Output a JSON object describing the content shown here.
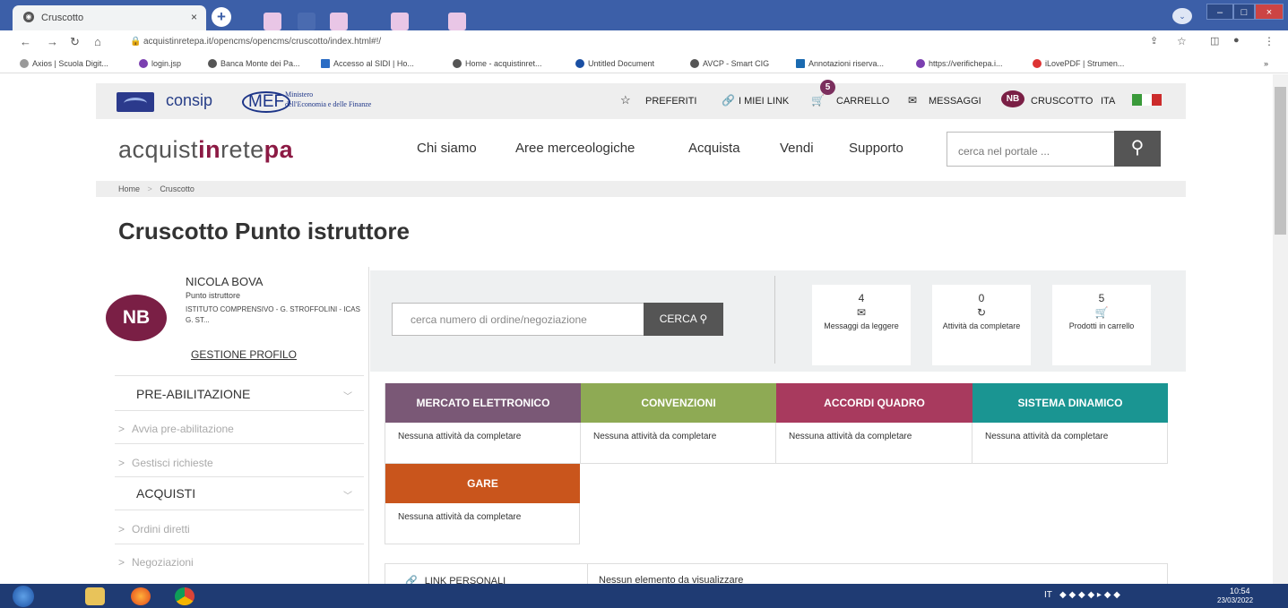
{
  "browser": {
    "tab_title": "Cruscotto",
    "tab_close": "×",
    "new_tab": "+",
    "url": "acquistinretepa.it/opencms/opencms/cruscotto/index.html#!/",
    "bookmarks": [
      "Axios | Scuola Digit...",
      "login.jsp",
      "Banca Monte dei Pa...",
      "Accesso al SIDI | Ho...",
      "Home - acquistinret...",
      "Untitled Document",
      "AVCP - Smart CIG",
      "Annotazioni riserva...",
      "https://verifichepa.i...",
      "iLovePDF | Strumen..."
    ]
  },
  "header": {
    "consip": "consip",
    "mef": "MEF",
    "mef_line1": "Ministero",
    "mef_line2": "dell'Economia e delle Finanze",
    "links": {
      "preferiti": "PREFERITI",
      "miei_link": "I MIEI LINK",
      "carrello": "CARRELLO",
      "cart_count": "5",
      "messaggi": "MESSAGGI",
      "user_initials": "NB",
      "cruscotto": "CRUSCOTTO",
      "lang": "ITA"
    },
    "brand_a": "acquist",
    "brand_b": "in",
    "brand_c": "rete",
    "brand_d": "pa",
    "menu": [
      "Chi siamo",
      "Aree merceologiche",
      "Acquista",
      "Vendi",
      "Supporto"
    ],
    "search_placeholder": "cerca nel portale ..."
  },
  "breadcrumb": {
    "home": "Home",
    "sep": ">",
    "current": "Cruscotto"
  },
  "page_title": "Cruscotto Punto istruttore",
  "profile": {
    "initials": "NB",
    "name": "NICOLA BOVA",
    "role": "Punto istruttore",
    "org": "ISTITUTO COMPRENSIVO - G. STROFFOLINI - ICAS G. ST...",
    "manage": "GESTIONE PROFILO"
  },
  "sidebar": {
    "sections": [
      {
        "title": "PRE-ABILITAZIONE",
        "items": [
          "Avvia pre-abilitazione",
          "Gestisci richieste"
        ]
      },
      {
        "title": "ACQUISTI",
        "items": [
          "Ordini diretti",
          "Negoziazioni"
        ]
      }
    ]
  },
  "order_search": {
    "placeholder": "cerca numero di ordine/negoziazione",
    "button": "CERCA"
  },
  "stats": [
    {
      "value": "4",
      "label": "Messaggi da leggere"
    },
    {
      "value": "0",
      "label": "Attività da completare"
    },
    {
      "value": "5",
      "label": "Prodotti in carrello"
    }
  ],
  "categories": [
    {
      "title": "MERCATO ELETTRONICO",
      "color": "#7a5876",
      "status": "Nessuna attività da completare"
    },
    {
      "title": "CONVENZIONI",
      "color": "#8eaa54",
      "status": "Nessuna attività da completare"
    },
    {
      "title": "ACCORDI QUADRO",
      "color": "#a83a5e",
      "status": "Nessuna attività da completare"
    },
    {
      "title": "SISTEMA DINAMICO",
      "color": "#1a9592",
      "status": "Nessuna attività da completare"
    },
    {
      "title": "GARE",
      "color": "#c9551c",
      "status": "Nessuna attività da completare"
    }
  ],
  "links_box": {
    "title": "LINK PERSONALI",
    "empty": "Nessun elemento da visualizzare"
  },
  "taskbar": {
    "lang": "IT",
    "time": "10:54",
    "date": "23/03/2022"
  }
}
